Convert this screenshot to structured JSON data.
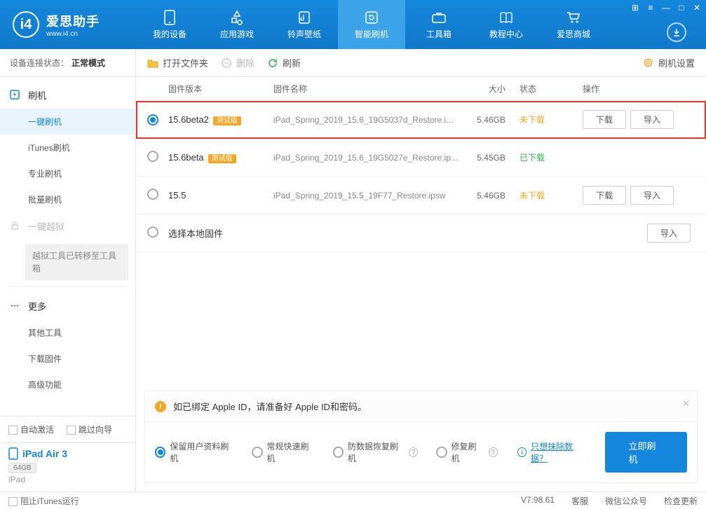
{
  "app": {
    "title": "爱思助手",
    "url": "www.i4.cn"
  },
  "nav": {
    "items": [
      {
        "label": "我的设备"
      },
      {
        "label": "应用游戏"
      },
      {
        "label": "铃声壁纸"
      },
      {
        "label": "智能刷机"
      },
      {
        "label": "工具箱"
      },
      {
        "label": "教程中心"
      },
      {
        "label": "爱思商城"
      }
    ]
  },
  "sidebar": {
    "conn_label": "设备连接状态：",
    "conn_value": "正常模式",
    "group_flash": "刷机",
    "items_flash": [
      "一键刷机",
      "iTunes刷机",
      "专业刷机",
      "批量刷机"
    ],
    "group_jail": "一键越狱",
    "jail_note": "越狱工具已转移至工具箱",
    "group_more": "更多",
    "items_more": [
      "其他工具",
      "下载固件",
      "高级功能"
    ],
    "chk_auto": "自动激活",
    "chk_skip": "跳过向导",
    "device_name": "iPad Air 3",
    "device_cap": "64GB",
    "device_type": "iPad"
  },
  "toolbar": {
    "open": "打开文件夹",
    "delete": "删除",
    "refresh": "刷新",
    "settings": "刷机设置"
  },
  "columns": {
    "ver": "固件版本",
    "name": "固件名称",
    "size": "大小",
    "status": "状态",
    "ops": "操作"
  },
  "rows": [
    {
      "selected": true,
      "version": "15.6beta2",
      "beta": "测试版",
      "name": "iPad_Spring_2019_15.6_19G5037d_Restore.i...",
      "size": "5.46GB",
      "status": "未下载",
      "status_cls": "orange",
      "dl": "下载",
      "imp": "导入",
      "hl": true,
      "show_ops": true
    },
    {
      "selected": false,
      "version": "15.6beta",
      "beta": "测试版",
      "name": "iPad_Spring_2019_15.6_19G5027e_Restore.ip...",
      "size": "5.45GB",
      "status": "已下载",
      "status_cls": "green",
      "show_ops": false
    },
    {
      "selected": false,
      "version": "15.5",
      "beta": "",
      "name": "iPad_Spring_2019_15.5_19F77_Restore.ipsw",
      "size": "5.46GB",
      "status": "未下载",
      "status_cls": "orange",
      "dl": "下载",
      "imp": "导入",
      "show_ops": true
    }
  ],
  "local_row": {
    "label": "选择本地固件",
    "imp": "导入"
  },
  "notice": "如已绑定 Apple ID，请准备好 Apple ID和密码。",
  "options": {
    "o1": "保留用户资料刷机",
    "o2": "常规快速刷机",
    "o3": "防数据恢复刷机",
    "o4": "修复刷机",
    "link": "只想抹除数据？",
    "go": "立即刷机"
  },
  "footer": {
    "block": "阻止iTunes运行",
    "ver": "V7.98.61",
    "svc": "客服",
    "wx": "微信公众号",
    "upd": "检查更新"
  }
}
